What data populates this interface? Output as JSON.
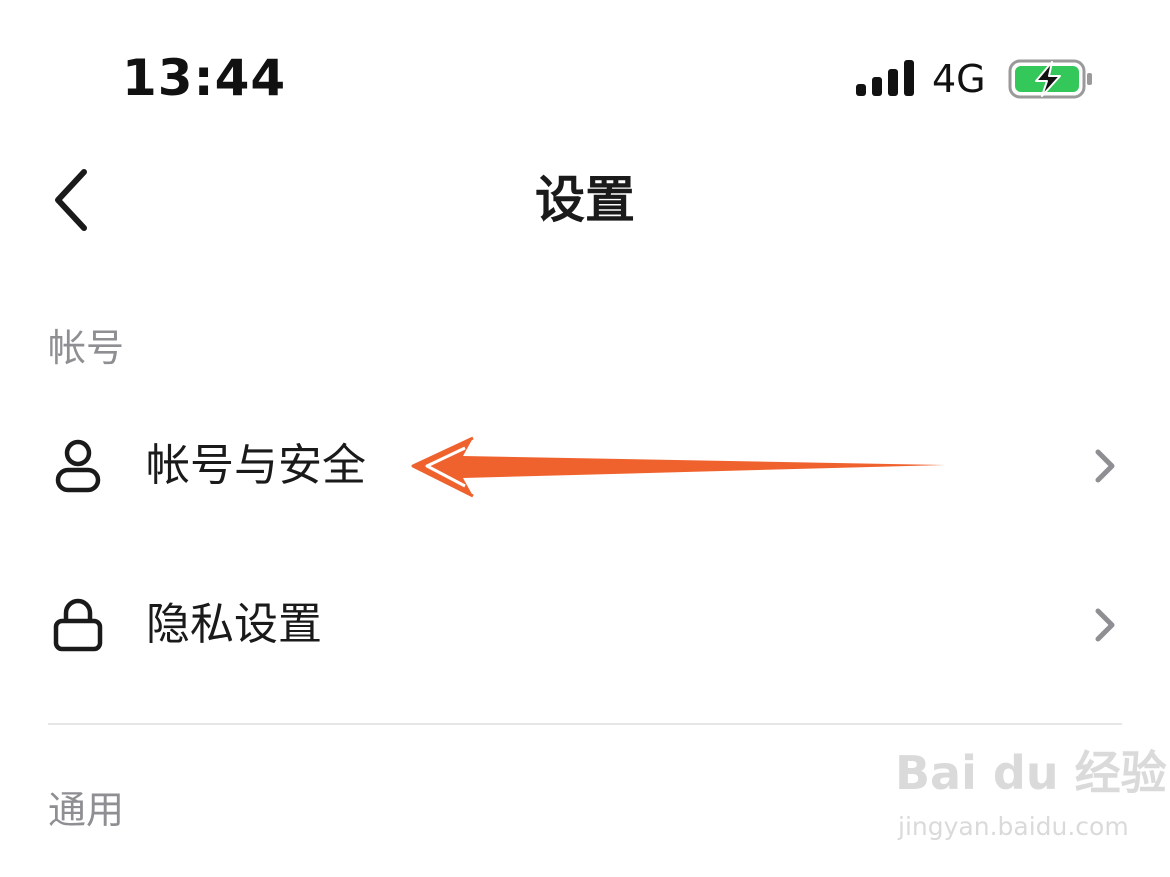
{
  "status_bar": {
    "time": "13:44",
    "network": "4G",
    "signal_icon": "signal-bars-icon",
    "battery_icon": "battery-charging-icon",
    "battery_color": "#34c759"
  },
  "nav": {
    "back_icon": "chevron-left-icon",
    "title": "设置"
  },
  "sections": [
    {
      "header": "帐号",
      "items": [
        {
          "label": "帐号与安全",
          "icon": "user-icon"
        },
        {
          "label": "隐私设置",
          "icon": "lock-icon"
        }
      ]
    },
    {
      "header": "通用",
      "items": []
    }
  ],
  "annotation": {
    "arrow_color": "#f0622d",
    "icon": "arrow-left-annotation"
  },
  "watermark": {
    "logo": "Bai du 经验",
    "url": "jingyan.baidu.com"
  }
}
